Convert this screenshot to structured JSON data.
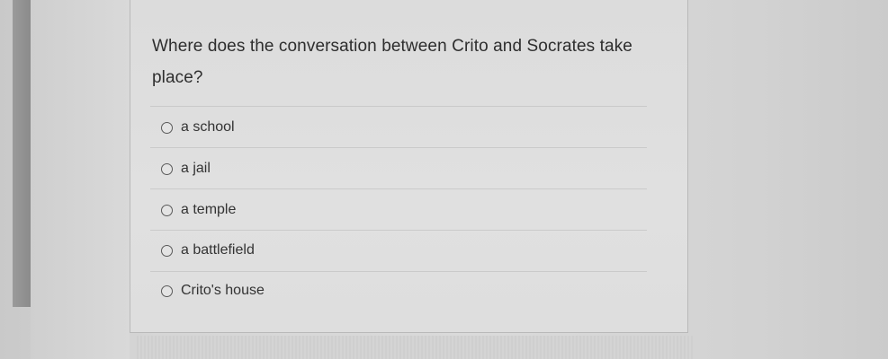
{
  "question": {
    "text": "Where does the conversation between Crito and Socrates take place?"
  },
  "options": [
    {
      "label": "a school"
    },
    {
      "label": "a jail"
    },
    {
      "label": "a temple"
    },
    {
      "label": "a battlefield"
    },
    {
      "label": "Crito's house"
    }
  ]
}
